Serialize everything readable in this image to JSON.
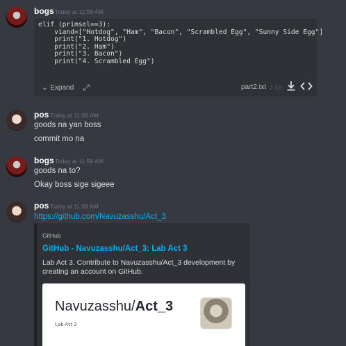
{
  "messages": [
    {
      "author": "bogs",
      "timestamp": "Today at 11:58 AM",
      "attachment": {
        "code": "elif (primsel==3):\n    viand=[\"Hotdog\", \"Ham\", \"Bacon\", \"Scrambled Egg\", \"Sunny Side Egg\"]\n    print(\"1. Hotdog\")\n    print(\"2. Ham\")\n    print(\"3. Bacon\")\n    print(\"4. Scrambled Egg\")",
        "expand_label": "Expand",
        "filename": "part2.txt",
        "filesize": "2 KB"
      }
    },
    {
      "author": "pos",
      "timestamp": "Today at 11:59 AM",
      "lines": [
        "goods na yan boss",
        "commit mo na"
      ]
    },
    {
      "author": "bogs",
      "timestamp": "Today at 11:59 AM",
      "lines": [
        "goods na to?",
        "Okay boss sige sigeee"
      ]
    },
    {
      "author": "pos",
      "timestamp": "Today at 11:59 AM",
      "link": "https://github.com/Navuzasshu/Act_3",
      "embed": {
        "provider": "GitHub",
        "title": "GitHub - Navuzasshu/Act_3: Lab Act 3",
        "description": "Lab Act 3. Contribute to Navuzasshu/Act_3 development by creating an account on GitHub.",
        "image_owner": "Navuzasshu/",
        "image_repo": "Act_3",
        "image_subtitle": "Lab Act 3"
      }
    }
  ],
  "colors": {
    "background": "#36393f",
    "embed_background": "#2f3136",
    "link": "#00b0f4",
    "author": "#ffffff",
    "timestamp": "#72767d"
  }
}
